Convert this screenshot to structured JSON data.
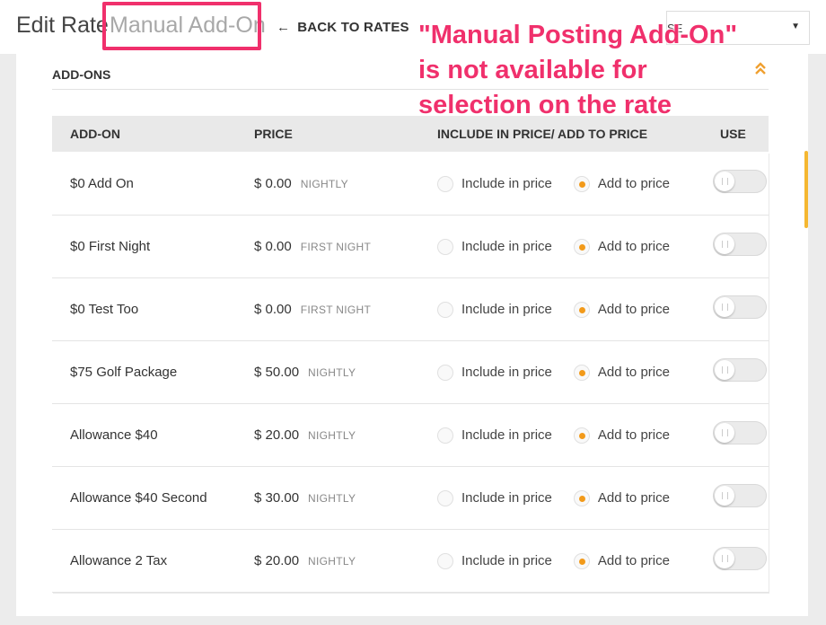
{
  "header": {
    "title": "Edit Rate",
    "subtitle": "Manual Add-On",
    "back_label": "BACK TO RATES",
    "back_icon": "arrow-left-icon",
    "select_visible_text": "SE",
    "select_caret": "▼"
  },
  "annotation": {
    "lines": [
      "\"Manual Posting Add-On\"",
      "is not available for",
      "selection on the rate"
    ],
    "color": "#f0306c"
  },
  "section": {
    "title": "ADD-ONS",
    "collapse_icon": "double-chevron-up-icon",
    "accent_color": "#f29a1a"
  },
  "table": {
    "headers": {
      "addon": "ADD-ON",
      "price": "PRICE",
      "include": "INCLUDE IN PRICE/ ADD TO PRICE",
      "use": "USE"
    },
    "include_label": "Include in price",
    "add_label": "Add to price",
    "rows": [
      {
        "name": "$0 Add On",
        "price": "$ 0.00",
        "frequency": "NIGHTLY",
        "selected": "add",
        "use": false
      },
      {
        "name": "$0 First Night",
        "price": "$ 0.00",
        "frequency": "FIRST NIGHT",
        "selected": "add",
        "use": false
      },
      {
        "name": "$0 Test Too",
        "price": "$ 0.00",
        "frequency": "FIRST NIGHT",
        "selected": "add",
        "use": false
      },
      {
        "name": "$75 Golf Package",
        "price": "$ 50.00",
        "frequency": "NIGHTLY",
        "selected": "add",
        "use": false
      },
      {
        "name": "Allowance $40",
        "price": "$ 20.00",
        "frequency": "NIGHTLY",
        "selected": "add",
        "use": false
      },
      {
        "name": "Allowance $40 Second",
        "price": "$ 30.00",
        "frequency": "NIGHTLY",
        "selected": "add",
        "use": false
      },
      {
        "name": "Allowance 2 Tax",
        "price": "$ 20.00",
        "frequency": "NIGHTLY",
        "selected": "add",
        "use": false
      }
    ]
  }
}
